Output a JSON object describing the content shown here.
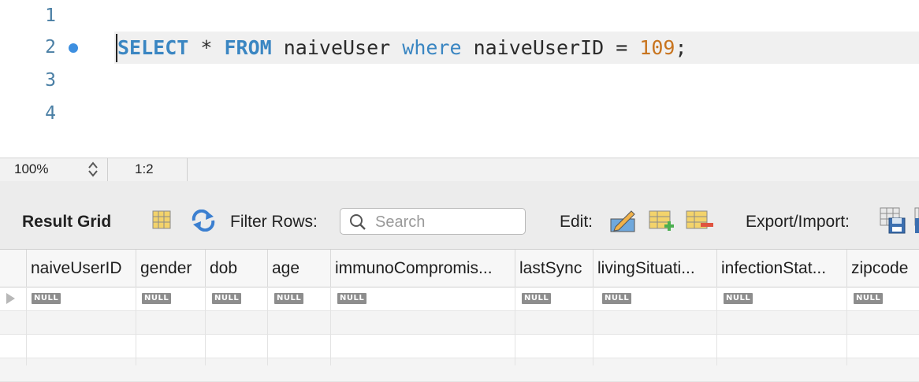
{
  "editor": {
    "line_numbers": [
      "1",
      "2",
      "3",
      "4"
    ],
    "current_line": 2,
    "code": {
      "kw_select": "SELECT",
      "star": " * ",
      "kw_from": "FROM",
      "table": " naiveUser ",
      "kw_where": "where",
      "column": " naiveUserID = ",
      "value": "109",
      "terminator": ";"
    }
  },
  "statusbar": {
    "zoom": "100%",
    "cursor_position": "1:2"
  },
  "toolbar": {
    "result_grid_label": "Result Grid",
    "filter_label": "Filter Rows:",
    "search_placeholder": "Search",
    "search_value": "",
    "edit_label": "Edit:",
    "export_label": "Export/Import:",
    "icons": [
      "grid-layout-icon",
      "refresh-icon",
      "search-icon",
      "edit-pencil-icon",
      "add-row-icon",
      "delete-row-icon",
      "export-icon",
      "import-icon"
    ]
  },
  "grid": {
    "columns": [
      "naiveUserID",
      "gender",
      "dob",
      "age",
      "immunoCompromis...",
      "lastSync",
      "livingSituati...",
      "infectionStat...",
      "zipcode"
    ],
    "rows": [
      [
        "NULL",
        "NULL",
        "NULL",
        "NULL",
        "NULL",
        "NULL",
        "NULL",
        "NULL",
        "NULL"
      ]
    ]
  },
  "colors": {
    "keyword": "#3a86c2",
    "number": "#c8741e",
    "line_number": "#4a7fa5",
    "breakpoint": "#3d8fe0",
    "null_badge": "#8d8d8d"
  }
}
